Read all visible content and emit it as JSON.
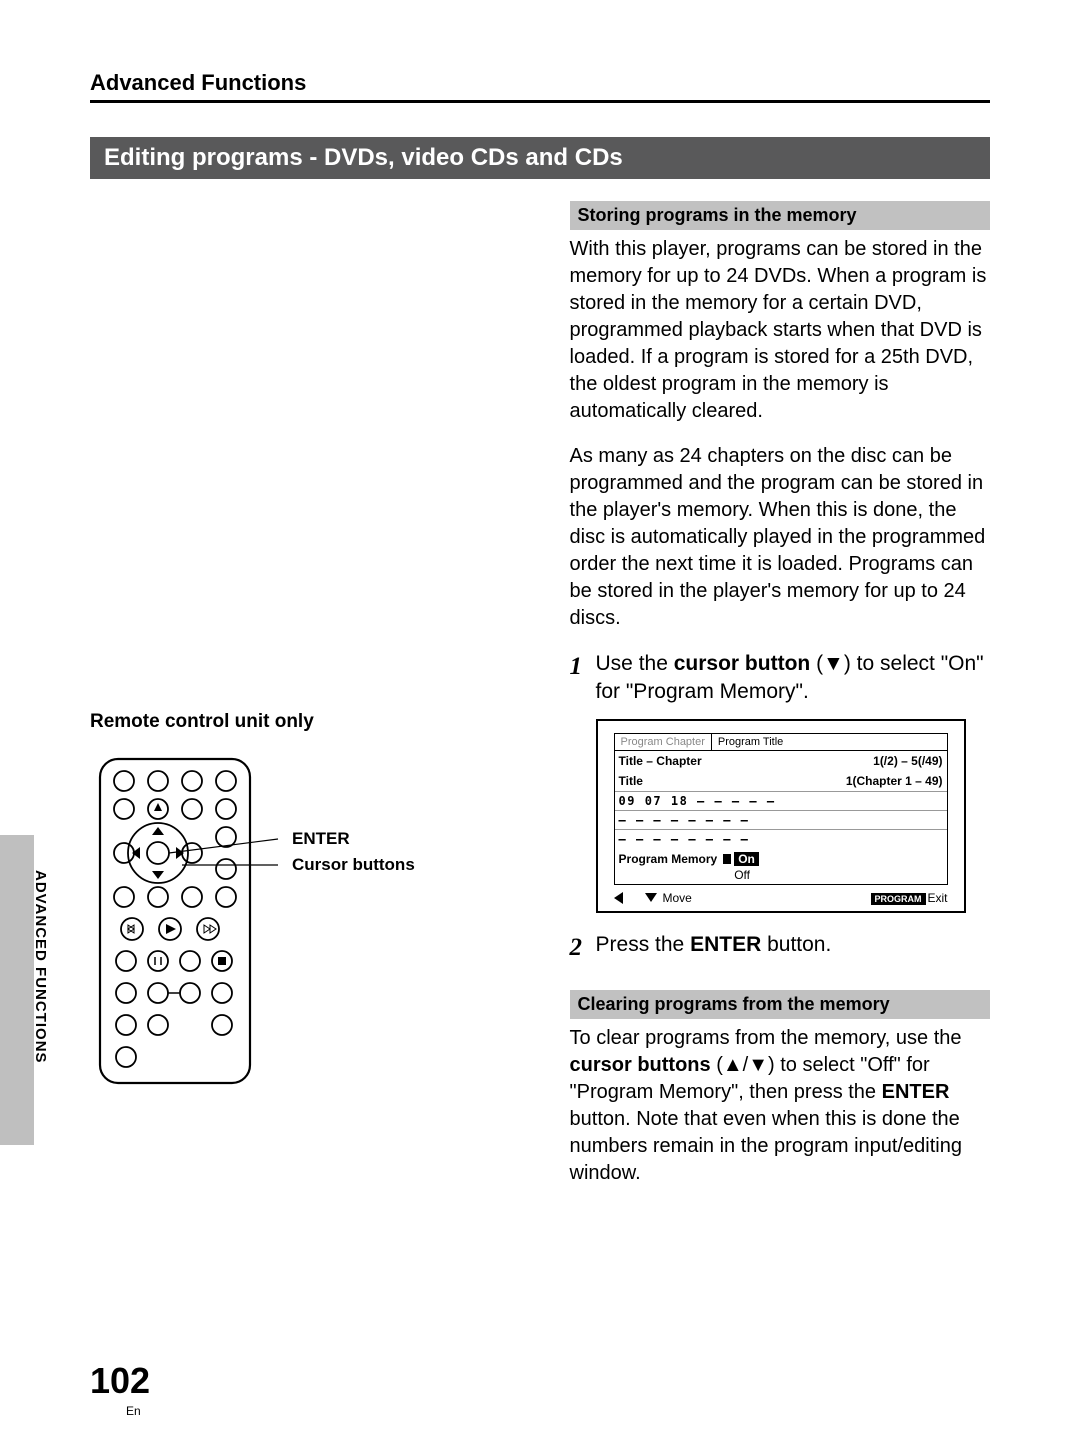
{
  "header": "Advanced Functions",
  "title_bar": "Editing programs - DVDs, video CDs and CDs",
  "sidebar": "ADVANCED FUNCTIONS",
  "page_number": "102",
  "page_lang": "En",
  "left": {
    "remote_label": "Remote control unit only",
    "callout1": "ENTER",
    "callout2": "Cursor buttons"
  },
  "right": {
    "sub1": "Storing programs in the memory",
    "para1": "With this player, programs can be stored in the memory for up to 24 DVDs.  When a program is stored in the memory for a certain DVD, programmed playback starts when that DVD is loaded.  If a program is stored for a 25th DVD, the oldest program in the memory is automatically cleared.",
    "para2": "As many as 24 chapters on the disc can be programmed and the program can be stored in the player's memory.  When this is done, the disc is automatically played in the programmed order the next time it is loaded.  Programs can be stored in the player's memory for up to 24 discs.",
    "step1_num": "1",
    "step1_a": "Use the ",
    "step1_b": "cursor button",
    "step1_c": " (▼) to select \"On\" for \"Program Memory\".",
    "step2_num": "2",
    "step2_a": "Press the ",
    "step2_b": "ENTER",
    "step2_c": " button.",
    "sub2": "Clearing programs from the memory",
    "para3_a": "To clear programs from the memory, use the ",
    "para3_b": "cursor buttons",
    "para3_c": " (▲/▼) to select \"Off\" for \"Program Memory\", then press the ",
    "para3_d": "ENTER",
    "para3_e": " button.  Note that even when this is done the numbers remain in the program input/editing window."
  },
  "osd": {
    "tab1": "Program Chapter",
    "tab2": "Program Title",
    "row1_l": "Title – Chapter",
    "row1_r": "1(/2) – 5(/49)",
    "row2_l": "Title",
    "row2_r": "1(Chapter 1 – 49)",
    "grid1": "09  07  18  —   —   —   —   —",
    "grid2": "—   —   —   —   —   —   —   —",
    "grid3": "—   —   —   —   —   —   —   —",
    "pm_label": "Program Memory",
    "pm_on": "On",
    "pm_off": "Off",
    "move": "Move",
    "program": "PROGRAM",
    "exit": "Exit"
  }
}
